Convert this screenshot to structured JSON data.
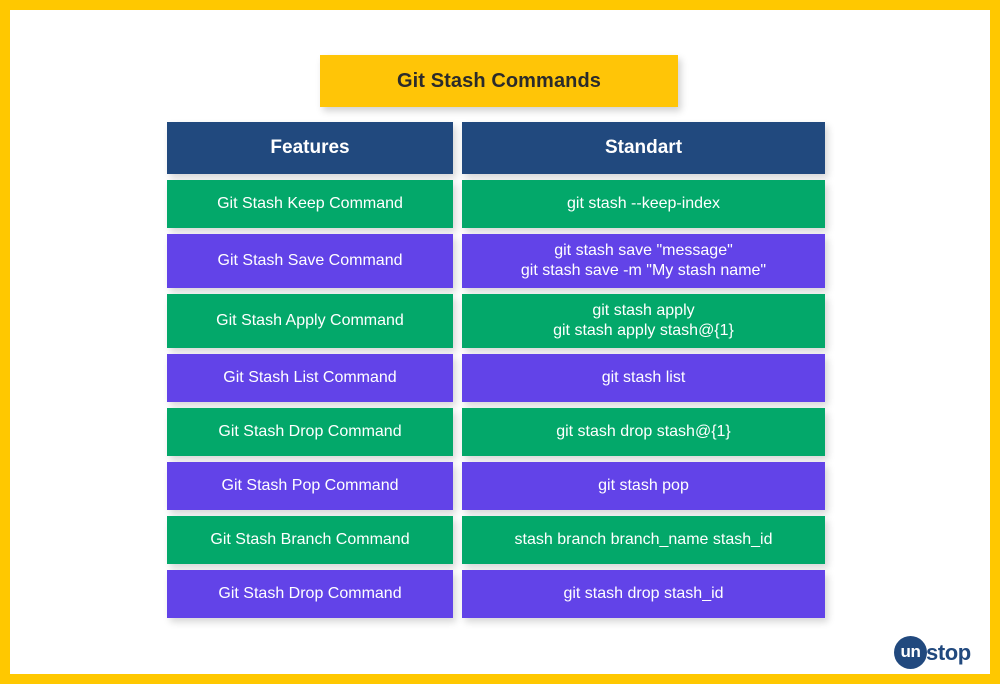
{
  "frame": {
    "border_color": "#FFC800"
  },
  "title": {
    "text": "Git Stash Commands",
    "background_color": "#FFC507",
    "text_color": "#2b2b2b"
  },
  "table": {
    "header": {
      "background_color": "#21497E",
      "columns": [
        {
          "label": "Features"
        },
        {
          "label": "Standart"
        }
      ]
    },
    "row_colors": {
      "green": "#03A86A",
      "purple": "#6243E8"
    },
    "rows": [
      {
        "color": "green",
        "feature": "Git Stash Keep Command",
        "command_lines": [
          "git stash --keep-index"
        ]
      },
      {
        "color": "purple",
        "feature": "Git Stash Save Command",
        "command_lines": [
          "git stash save \"message\"",
          "git stash save -m \"My stash name\""
        ]
      },
      {
        "color": "green",
        "feature": "Git Stash Apply Command",
        "command_lines": [
          "git stash apply",
          "git stash apply stash@{1}"
        ]
      },
      {
        "color": "purple",
        "feature": "Git Stash List Command",
        "command_lines": [
          "git stash list"
        ]
      },
      {
        "color": "green",
        "feature": "Git Stash Drop Command",
        "command_lines": [
          "git stash drop stash@{1}"
        ]
      },
      {
        "color": "purple",
        "feature": "Git Stash Pop Command",
        "command_lines": [
          "git stash pop"
        ]
      },
      {
        "color": "green",
        "feature": "Git Stash Branch Command",
        "command_lines": [
          "stash branch branch_name stash_id"
        ]
      },
      {
        "color": "purple",
        "feature": "Git Stash Drop Command",
        "command_lines": [
          "git stash drop stash_id"
        ]
      }
    ]
  },
  "logo": {
    "mark_text": "un",
    "word_text": "stop",
    "color": "#21497E"
  }
}
